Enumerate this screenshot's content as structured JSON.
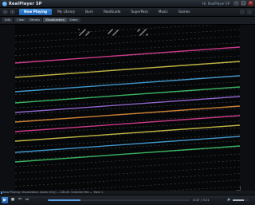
{
  "app": {
    "title": "RealPlayer SP",
    "user_label": "Hi, RealPlayer SP"
  },
  "window_controls": {
    "minimize": "–",
    "maximize": "□",
    "close": "×"
  },
  "nav": {
    "back": "‹",
    "forward": "›",
    "tabs": [
      {
        "label": "Now Playing",
        "active": true
      },
      {
        "label": "My Library",
        "active": false
      },
      {
        "label": "Burn",
        "active": false
      },
      {
        "label": "RealGuide",
        "active": false
      },
      {
        "label": "SuperPass",
        "active": false
      },
      {
        "label": "Music",
        "active": false
      },
      {
        "label": "Games",
        "active": false
      }
    ]
  },
  "subbar": {
    "items": [
      {
        "label": "Info",
        "active": false
      },
      {
        "label": "Clear",
        "active": false
      },
      {
        "label": "Details",
        "active": false
      },
      {
        "label": "Visualization",
        "active": true
      },
      {
        "label": "Video",
        "active": false
      }
    ]
  },
  "visualization": {
    "colors": [
      "#e0409a",
      "#d6c84a",
      "#49a6e0",
      "#3fc56a",
      "#a070e0",
      "#e0903a"
    ]
  },
  "status": {
    "text": "Now Playing: Visualization (Audio Only) — Album: Greatest Hits — Track 1"
  },
  "player": {
    "play_icon": "▶",
    "stop_icon": "■",
    "prev_icon": "⏮",
    "next_icon": "⏭",
    "time": "0:47 / 3:21",
    "volume_icon": "🔈",
    "progress": 0.23,
    "volume": 0.7
  }
}
